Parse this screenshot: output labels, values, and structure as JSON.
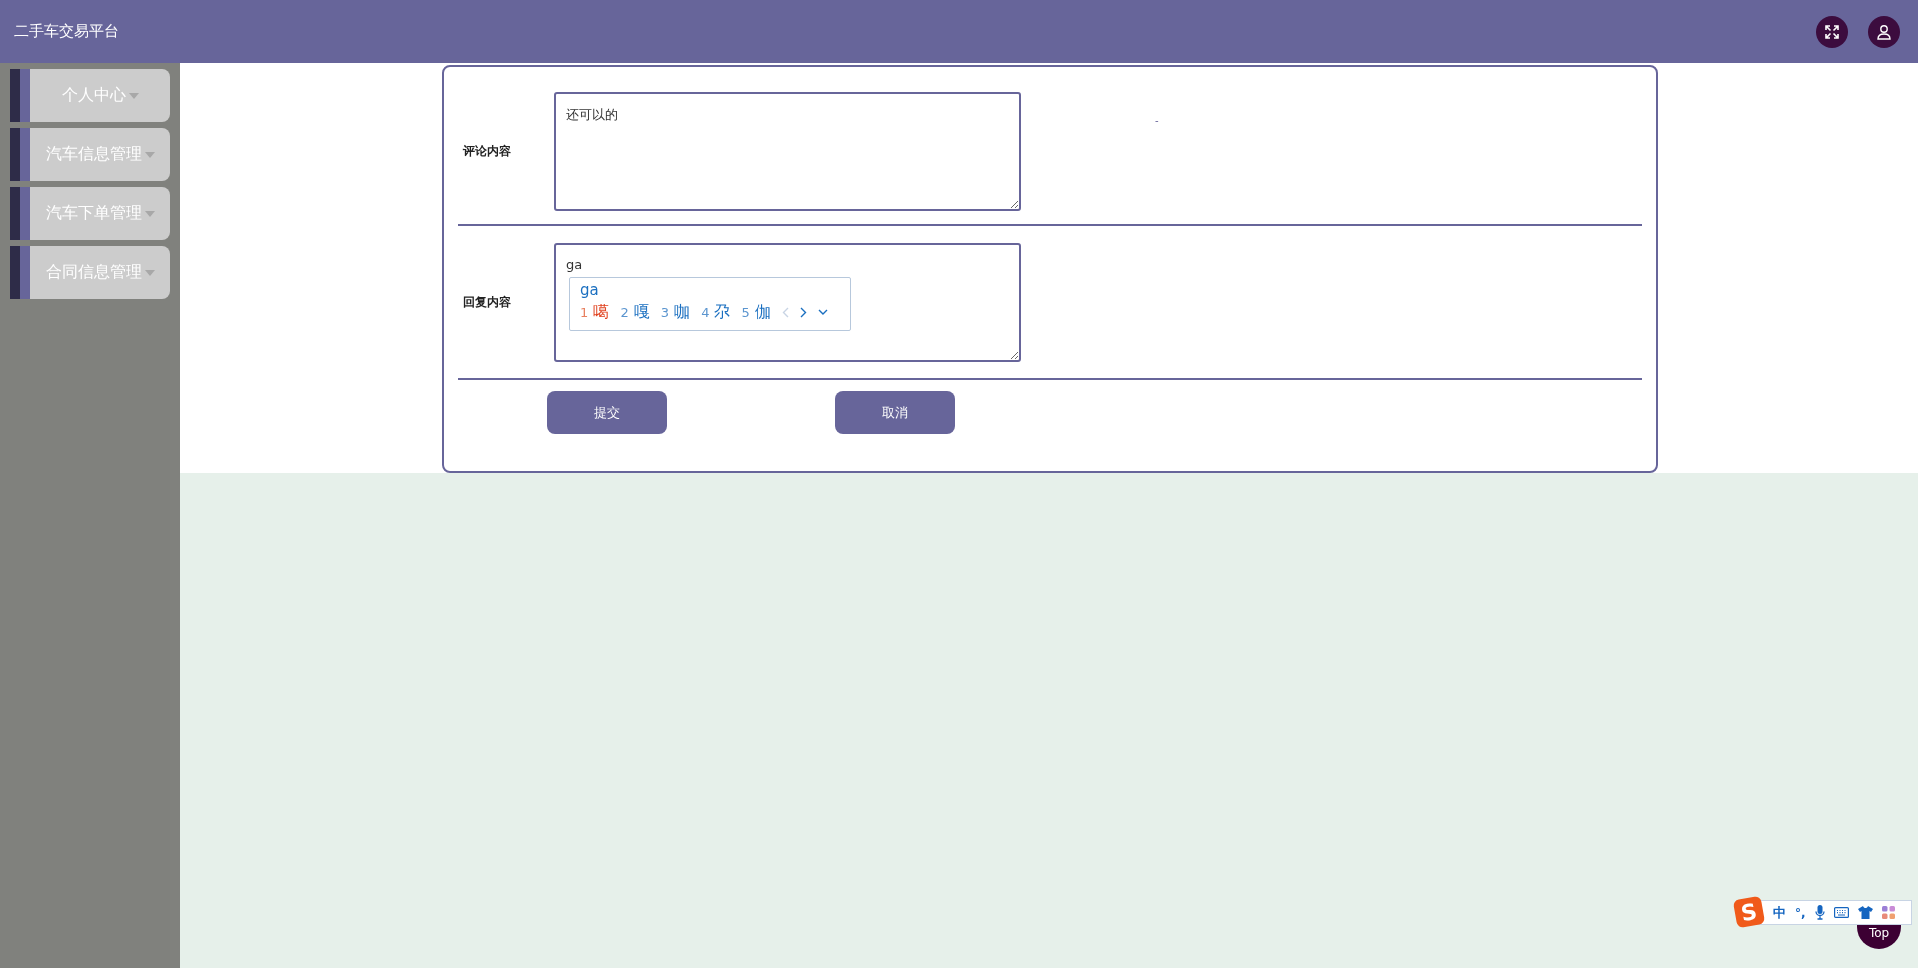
{
  "header": {
    "title": "二手车交易平台"
  },
  "sidebar": {
    "items": [
      {
        "label": "个人中心"
      },
      {
        "label": "汽车信息管理"
      },
      {
        "label": "汽车下单管理"
      },
      {
        "label": "合同信息管理"
      }
    ]
  },
  "form": {
    "fields": [
      {
        "label": "评论内容",
        "value": "还可以的"
      },
      {
        "label": "回复内容",
        "value": "ga"
      }
    ],
    "stray_mark": "-",
    "buttons": [
      {
        "label": "提交"
      },
      {
        "label": "取消"
      }
    ]
  },
  "ime_popup": {
    "composition": "ga",
    "candidates": [
      {
        "number": "1",
        "text": "噶",
        "selected": true
      },
      {
        "number": "2",
        "text": "嘎",
        "selected": false
      },
      {
        "number": "3",
        "text": "咖",
        "selected": false
      },
      {
        "number": "4",
        "text": "尕",
        "selected": false
      },
      {
        "number": "5",
        "text": "伽",
        "selected": false
      }
    ],
    "prev_disabled": true
  },
  "ime_toolbar": {
    "logo": "S",
    "mode": "中",
    "punctuation": "°,"
  },
  "back_to_top": {
    "label": "Top"
  }
}
